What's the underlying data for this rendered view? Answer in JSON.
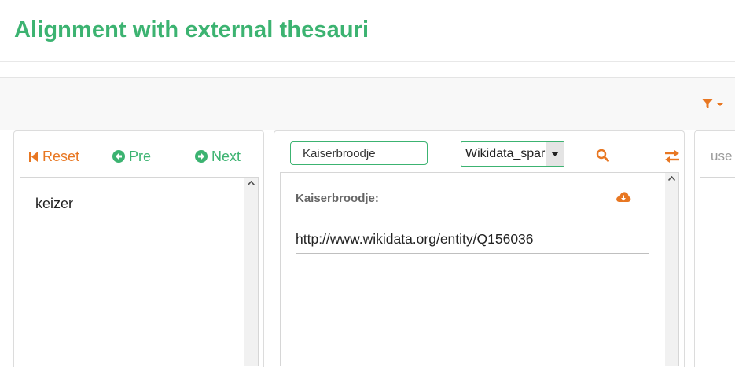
{
  "header": {
    "title": "Alignment with external thesauri"
  },
  "toolbar": {
    "filter_icon": "filter-icon",
    "accent_color": "#e87722"
  },
  "navigation": {
    "reset_label": "Reset",
    "pre_label": "Pre",
    "next_label": "Next"
  },
  "term_list": {
    "items": [
      "keizer"
    ]
  },
  "search": {
    "value": "Kaiserbroodje",
    "source_selected": "Wikidata_spar",
    "user_peek": "use"
  },
  "result": {
    "term_label": "Kaiserbroodje:",
    "uri": "http://www.wikidata.org/entity/Q156036"
  },
  "colors": {
    "brand_green": "#3cb371",
    "accent_orange": "#e87722"
  }
}
